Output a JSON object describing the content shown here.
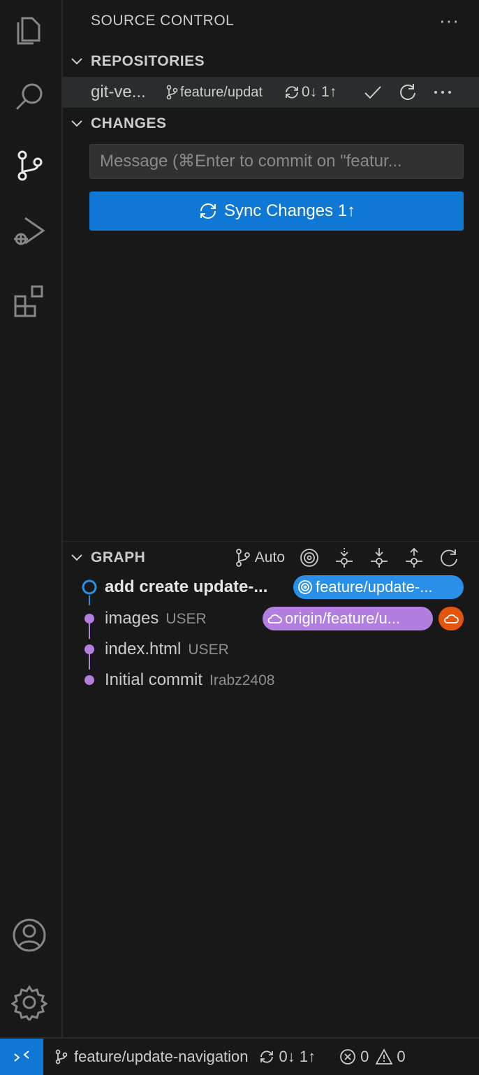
{
  "activity_bar": {
    "items": [
      "explorer-icon",
      "search-icon",
      "source-control-icon",
      "run-debug-icon",
      "extensions-icon"
    ],
    "bottom": [
      "account-icon",
      "settings-icon"
    ]
  },
  "sidebar": {
    "title": "SOURCE CONTROL",
    "more": "···"
  },
  "repositories": {
    "header": "REPOSITORIES",
    "repo_name": "git-ve...",
    "branch": "feature/updat",
    "sync_status": "0↓ 1↑"
  },
  "changes": {
    "header": "CHANGES",
    "commit_placeholder": "Message (⌘Enter to commit on \"featur...",
    "sync_button_label": "Sync Changes 1↑"
  },
  "graph": {
    "header": "GRAPH",
    "auto_label": "Auto",
    "commits": [
      {
        "message": "add create update-...",
        "author": "",
        "badge": "feature/update-..."
      },
      {
        "message": "images",
        "author": "USER",
        "badge": "origin/feature/u..."
      },
      {
        "message": "index.html",
        "author": "USER",
        "badge": ""
      },
      {
        "message": "Initial commit",
        "author": "Irabz2408",
        "badge": ""
      }
    ]
  },
  "status_bar": {
    "branch": "feature/update-navigation",
    "sync": "0↓ 1↑",
    "errors": "0",
    "warnings": "0"
  },
  "colors": {
    "accent": "#0e78d4",
    "local_badge": "#2a8fe8",
    "remote_badge": "#b27ee0",
    "cloud_badge": "#e5540c",
    "graph_line": "#b27ee0",
    "head_node": "#2a8fe8"
  }
}
